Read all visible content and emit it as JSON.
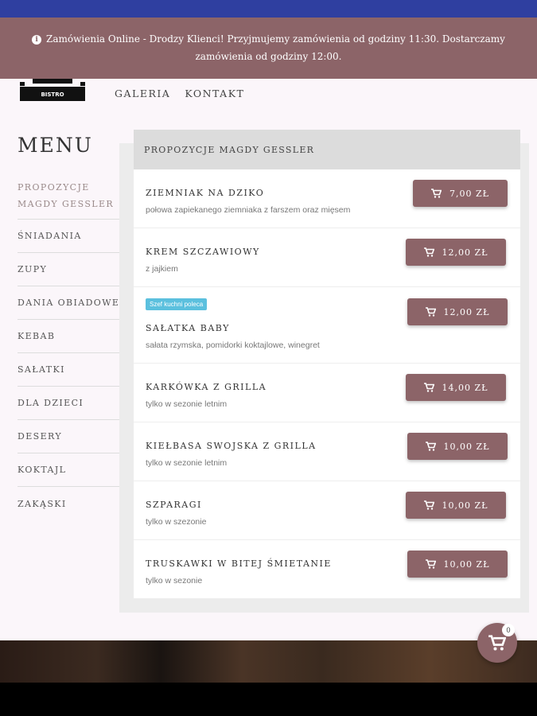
{
  "notice": {
    "text": "Zamówienia Online - Drodzy Klienci! Przyjmujemy zamówienia od godziny 11:30. Dostarczamy zamówienia od godziny 12:00.",
    "icon": "info-icon"
  },
  "logo": {
    "text": "BISTRO"
  },
  "nav": [
    {
      "label": "GALERIA"
    },
    {
      "label": "KONTAKT"
    }
  ],
  "menu_title": "MENU",
  "sidebar": [
    {
      "label": "PROPOZYCJE MAGDY GESSLER"
    },
    {
      "label": "ŚNIADANIA"
    },
    {
      "label": "ZUPY"
    },
    {
      "label": "DANIA OBIADOWE"
    },
    {
      "label": "KEBAB"
    },
    {
      "label": "SAŁATKI"
    },
    {
      "label": "DLA DZIECI"
    },
    {
      "label": "DESERY"
    },
    {
      "label": "KOKTAJL"
    },
    {
      "label": "ZAKĄSKI"
    }
  ],
  "panel": {
    "header": "PROPOZYCJE MAGDY GESSLER",
    "items": [
      {
        "name": "ZIEMNIAK NA DZIKO",
        "desc": "połowa zapiekanego ziemniaka z farszem oraz mięsem",
        "price": "7,00 ZŁ",
        "badge": ""
      },
      {
        "name": "KREM SZCZAWIOWY",
        "desc": "z jajkiem",
        "price": "12,00 ZŁ",
        "badge": ""
      },
      {
        "name": "SAŁATKA BABY",
        "desc": "sałata rzymska, pomidorki koktajlowe, winegret",
        "price": "12,00 ZŁ",
        "badge": "Szef kuchni poleca"
      },
      {
        "name": "KARKÓWKA Z GRILLA",
        "desc": "tylko w sezonie letnim",
        "price": "14,00 ZŁ",
        "badge": ""
      },
      {
        "name": "KIEŁBASA SWOJSKA Z GRILLA",
        "desc": "tylko w sezonie letnim",
        "price": "10,00 ZŁ",
        "badge": ""
      },
      {
        "name": "SZPARAGI",
        "desc": "tylko w szezonie",
        "price": "10,00 ZŁ",
        "badge": ""
      },
      {
        "name": "TRUSKAWKI W BITEJ ŚMIETANIE",
        "desc": "tylko w sezonie",
        "price": "10,00 ZŁ",
        "badge": ""
      }
    ]
  },
  "cart": {
    "count": "0",
    "icon": "cart-icon"
  },
  "colors": {
    "accent": "#8c6468",
    "topbar": "#2f3fa0",
    "badge": "#5bc0de"
  }
}
